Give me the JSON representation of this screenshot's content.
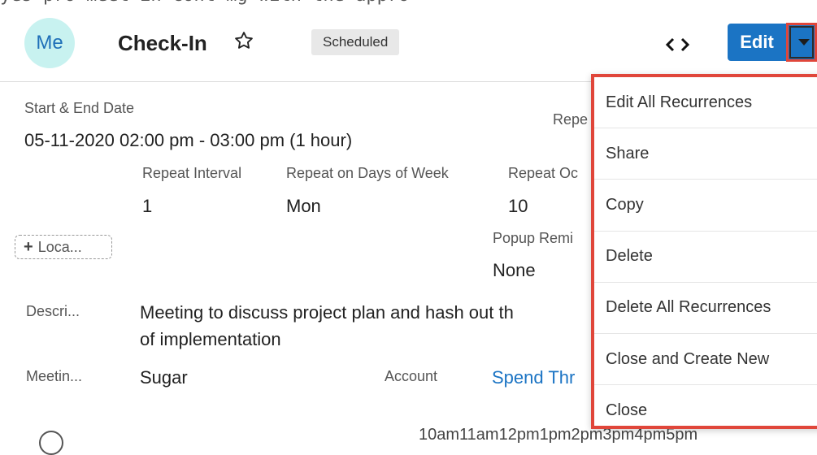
{
  "top_clip_text": "yes pro meet in cont mg with the appro",
  "header": {
    "avatar_initials": "Me",
    "title": "Check-In",
    "status": "Scheduled",
    "edit_label": "Edit",
    "star_icon": "star-outline-icon",
    "prev_icon": "chevron-left-icon",
    "next_icon": "chevron-right-icon",
    "caret_icon": "caret-down-icon"
  },
  "details": {
    "start_end_label": "Start & End Date",
    "start_end_value": "05-11-2020 02:00 pm - 03:00 pm (1 hour)",
    "repeat_type_label": "Repe",
    "repeat_interval_label": "Repeat Interval",
    "repeat_interval_value": "1",
    "repeat_days_label": "Repeat on Days of Week",
    "repeat_days_value": "Mon",
    "repeat_occ_label": "Repeat Oc",
    "repeat_occ_value": "10",
    "location_button": "Loca...",
    "popup_label": "Popup Remi",
    "popup_value": "None",
    "description_label": "Descri...",
    "description_line1": "Meeting to discuss project plan and hash out th",
    "description_line2": "of implementation",
    "meeting_label": "Meetin...",
    "meeting_value": "Sugar",
    "account_label": "Account",
    "account_value": "Spend Thr",
    "bottom_clip": "10am11am12pm1pm2pm3pm4pm5pm"
  },
  "menu": {
    "items": [
      "Edit All Recurrences",
      "Share",
      "Copy",
      "Delete",
      "Delete All Recurrences",
      "Close and Create New",
      "Close"
    ]
  },
  "colors": {
    "accent": "#1b74c4",
    "highlight_border": "#e0463a",
    "avatar_bg": "#c8f2f0"
  }
}
